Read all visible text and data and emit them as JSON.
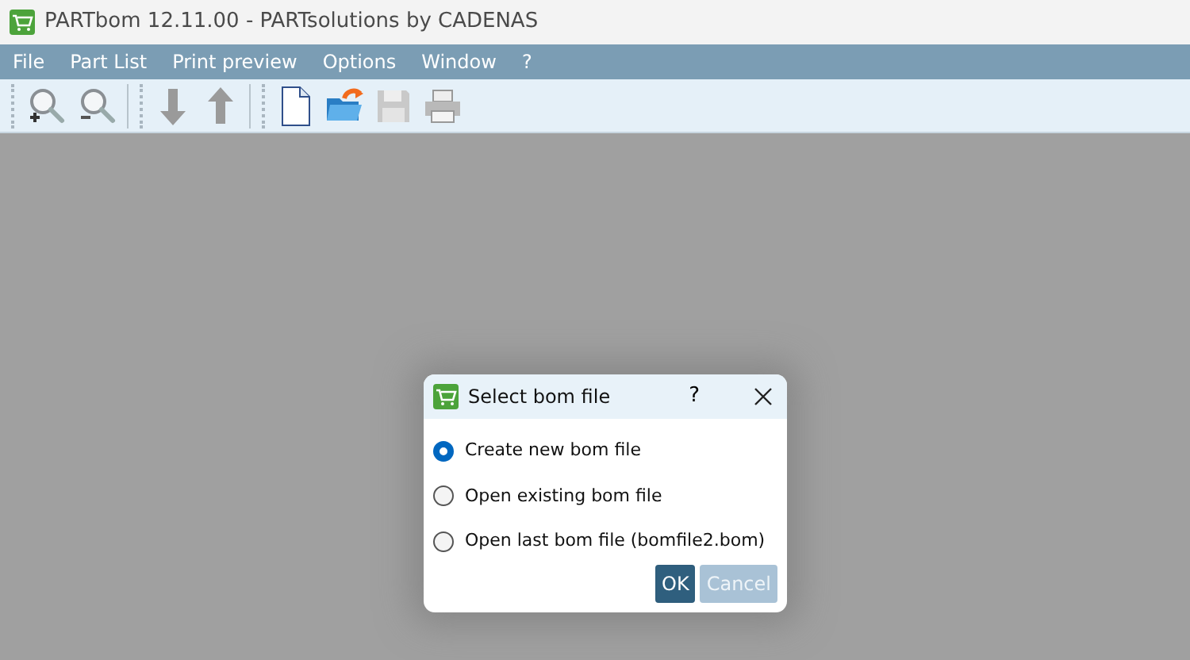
{
  "window": {
    "title": "PARTbom 12.11.00 - PARTsolutions by CADENAS"
  },
  "menu": [
    {
      "label": "File"
    },
    {
      "label": "Part List"
    },
    {
      "label": "Print preview"
    },
    {
      "label": "Options"
    },
    {
      "label": "Window"
    },
    {
      "label": "?"
    }
  ],
  "dialog": {
    "title": "Select bom file",
    "help": "?",
    "options": [
      {
        "label": "Create new bom file",
        "selected": true
      },
      {
        "label": "Open existing bom file",
        "selected": false
      },
      {
        "label": "Open last bom file (bomfile2.bom)",
        "selected": false
      }
    ],
    "buttons": [
      {
        "label": "OK",
        "disabled": false
      },
      {
        "label": "Cancel",
        "disabled": true
      }
    ]
  }
}
